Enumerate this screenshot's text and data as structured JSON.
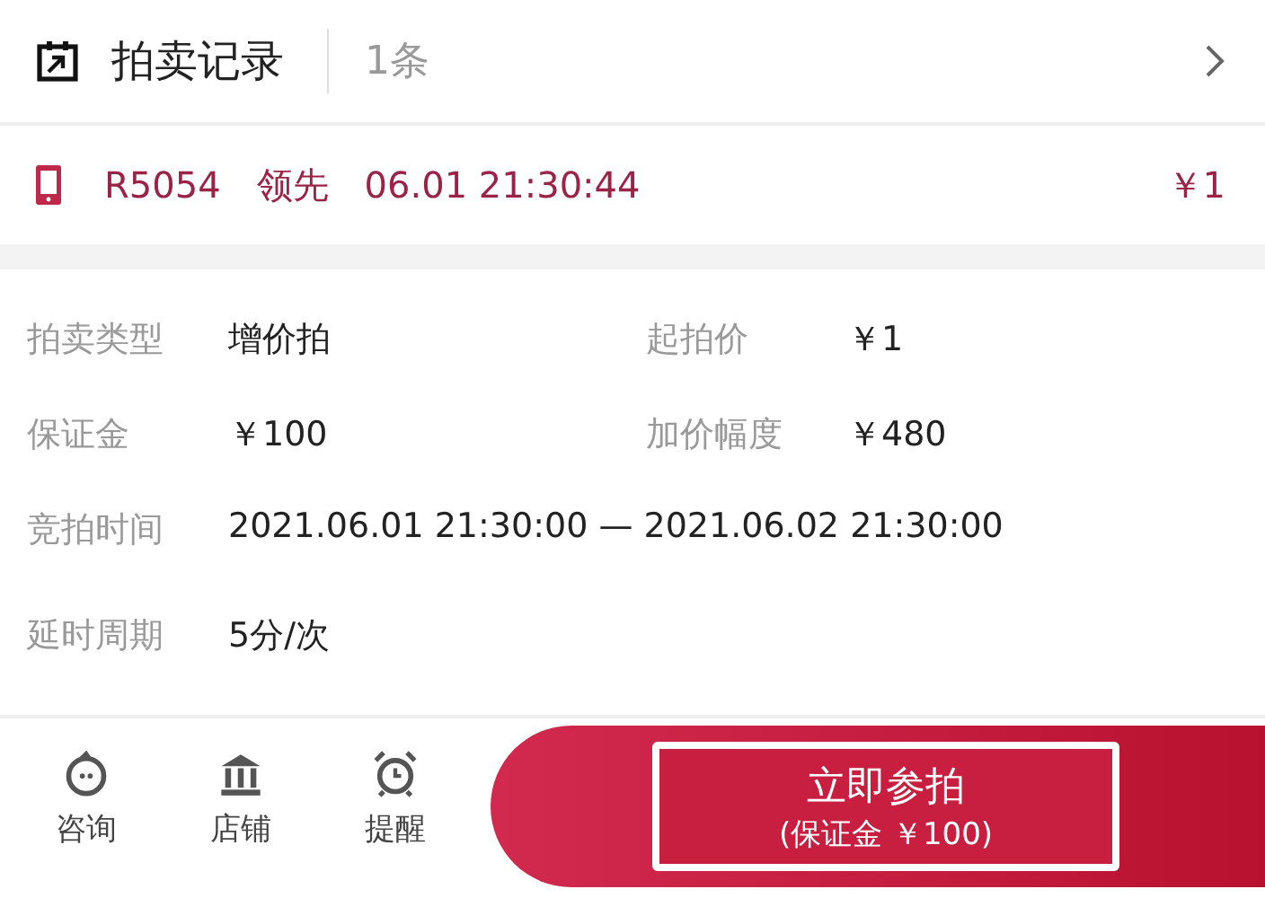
{
  "header": {
    "title": "拍卖记录",
    "count": "1条"
  },
  "record": {
    "bidder": "R5054",
    "status": "领先",
    "time": "06.01 21:30:44",
    "price": "￥1"
  },
  "details": [
    [
      {
        "label": "拍卖类型",
        "value": "增价拍"
      },
      {
        "label": "起拍价",
        "value": "￥1"
      }
    ],
    [
      {
        "label": "保证金",
        "value": "￥100"
      },
      {
        "label": "加价幅度",
        "value": "￥480"
      }
    ],
    [
      {
        "label": "竞拍时间",
        "value": "2021.06.01 21:30:00 — 2021.06.02 21:30:00"
      }
    ],
    [
      {
        "label": "延时周期",
        "value": "5分/次"
      }
    ]
  ],
  "footer": {
    "actions": [
      {
        "kind": "chat",
        "label": "咨询"
      },
      {
        "kind": "store",
        "label": "店铺"
      },
      {
        "kind": "alarm",
        "label": "提醒"
      }
    ],
    "cta": {
      "title": "立即参拍",
      "subtitle": "(保证金 ￥100)"
    }
  }
}
